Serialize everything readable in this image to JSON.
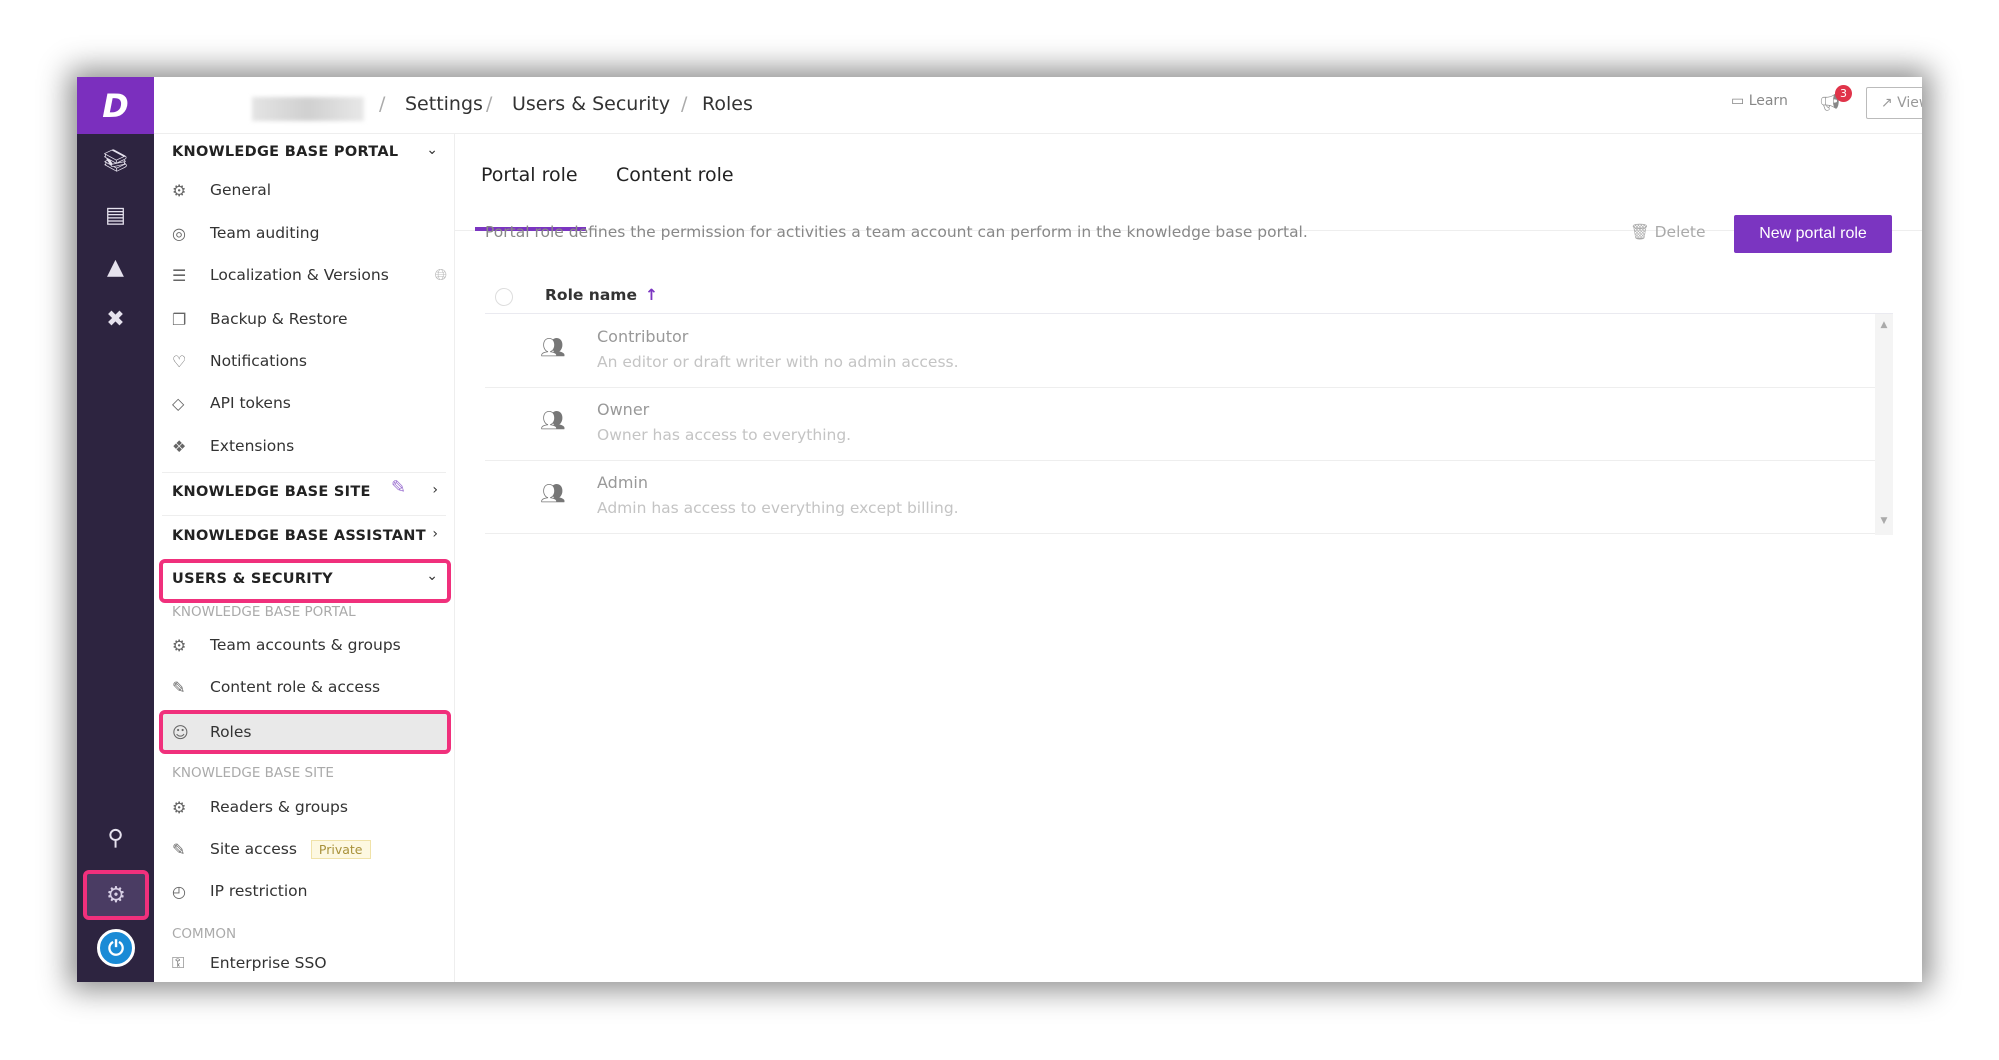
{
  "header": {
    "breadcrumb": [
      "Settings",
      "Users & Security",
      "Roles"
    ],
    "learn": "Learn",
    "notification_count": "3",
    "view_site": "View site"
  },
  "rail": {
    "icons": [
      "library-icon",
      "archive-icon",
      "analytics-icon",
      "tools-icon",
      "search-icon",
      "settings-icon",
      "power-icon"
    ]
  },
  "sidebar": {
    "kb_portal": {
      "title": "KNOWLEDGE BASE PORTAL",
      "items": [
        "General",
        "Team auditing",
        "Localization & Versions",
        "Backup & Restore",
        "Notifications",
        "API tokens",
        "Extensions"
      ]
    },
    "kb_site": "KNOWLEDGE BASE SITE",
    "kb_assistant": "KNOWLEDGE BASE ASSISTANT",
    "users_security": {
      "title": "USERS & SECURITY",
      "portal_label": "KNOWLEDGE BASE PORTAL",
      "portal_items": [
        "Team accounts & groups",
        "Content role & access",
        "Roles"
      ],
      "site_label": "KNOWLEDGE BASE SITE",
      "site_items": [
        "Readers & groups",
        "Site access",
        "IP restriction"
      ],
      "site_access_badge": "Private",
      "common_label": "COMMON",
      "common_items": [
        "Enterprise SSO"
      ]
    }
  },
  "main": {
    "tabs": [
      "Portal role",
      "Content role"
    ],
    "description": "Portal role defines the permission for activities a team account can perform in the knowledge base portal.",
    "delete": "Delete",
    "new_button": "New portal role",
    "column": "Role name",
    "roles": [
      {
        "name": "Contributor",
        "desc": "An editor or draft writer with no admin access."
      },
      {
        "name": "Owner",
        "desc": "Owner has access to everything."
      },
      {
        "name": "Admin",
        "desc": "Admin has access to everything except billing."
      }
    ]
  },
  "colors": {
    "accent": "#7b35c1",
    "highlight": "#f0307c",
    "rail": "#2d2440"
  }
}
